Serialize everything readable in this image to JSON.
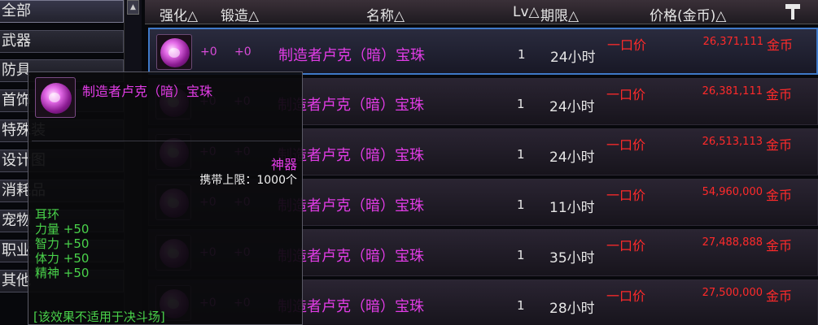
{
  "categories": [
    "全部",
    "武器",
    "防具",
    "首饰",
    "特殊装",
    "设计图",
    "消耗品",
    "宠物",
    "职业",
    "其他"
  ],
  "header": {
    "enhance": "强化△",
    "forge": "锻造△",
    "name": "名称△",
    "level": "Lv△",
    "duration": "期限△",
    "price": "价格(金币)△"
  },
  "listings": [
    {
      "enhance": "+0",
      "forge": "+0",
      "name": "制造者卢克（暗）宝珠",
      "level": "1",
      "duration": "24小时",
      "price_type": "一口价",
      "price": "26,371,111",
      "currency": "金币"
    },
    {
      "enhance": "+0",
      "forge": "+0",
      "name": "制造者卢克（暗）宝珠",
      "level": "1",
      "duration": "24小时",
      "price_type": "一口价",
      "price": "26,381,111",
      "currency": "金币"
    },
    {
      "enhance": "+0",
      "forge": "+0",
      "name": "制造者卢克（暗）宝珠",
      "level": "1",
      "duration": "24小时",
      "price_type": "一口价",
      "price": "26,513,113",
      "currency": "金币"
    },
    {
      "enhance": "+0",
      "forge": "+0",
      "name": "制造者卢克（暗）宝珠",
      "level": "1",
      "duration": "11小时",
      "price_type": "一口价",
      "price": "54,960,000",
      "currency": "金币"
    },
    {
      "enhance": "+0",
      "forge": "+0",
      "name": "制造者卢克（暗）宝珠",
      "level": "1",
      "duration": "35小时",
      "price_type": "一口价",
      "price": "27,488,888",
      "currency": "金币"
    },
    {
      "enhance": "+0",
      "forge": "+0",
      "name": "制造者卢克（暗）宝珠",
      "level": "1",
      "duration": "28小时",
      "price_type": "一口价",
      "price": "27,500,000",
      "currency": "金币"
    }
  ],
  "tooltip": {
    "name": "制造者卢克（暗）宝珠",
    "rarity": "神器",
    "carry_limit": "携带上限：1000个",
    "type": "耳环",
    "stats": [
      {
        "label": "力量",
        "value": "+50"
      },
      {
        "label": "智力",
        "value": "+50"
      },
      {
        "label": "体力",
        "value": "+50"
      },
      {
        "label": "精神",
        "value": "+50"
      }
    ],
    "note": "[该效果不适用于决斗场]"
  },
  "colors": {
    "item_name": "#e23ce6",
    "price": "#ff2a2a",
    "stat_green": "#49d24a",
    "selection_border": "#3f79c8"
  },
  "icons": {
    "item": "purple-orb-icon",
    "sort_hammer": "hammer-icon",
    "scroll_up": "scroll-up-arrow-icon"
  }
}
